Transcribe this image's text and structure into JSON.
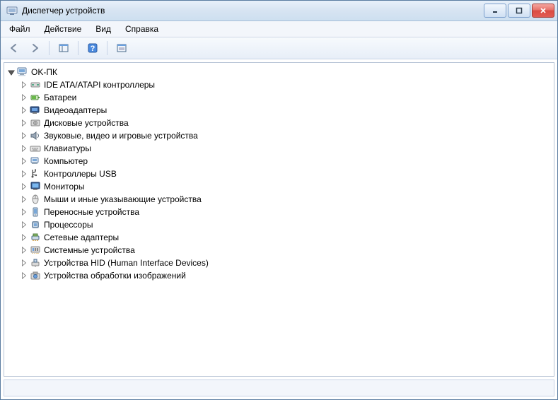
{
  "window": {
    "title": "Диспетчер устройств"
  },
  "menu": {
    "file": "Файл",
    "action": "Действие",
    "view": "Вид",
    "help": "Справка"
  },
  "tree": {
    "root": {
      "label": "OK-ПК",
      "expanded": true
    },
    "categories": [
      {
        "id": "ide",
        "label": "IDE ATA/ATAPI контроллеры",
        "icon": "controller-icon"
      },
      {
        "id": "battery",
        "label": "Батареи",
        "icon": "battery-icon"
      },
      {
        "id": "video",
        "label": "Видеоадаптеры",
        "icon": "display-adapter-icon"
      },
      {
        "id": "disk",
        "label": "Дисковые устройства",
        "icon": "disk-icon"
      },
      {
        "id": "sound",
        "label": "Звуковые, видео и игровые устройства",
        "icon": "sound-icon"
      },
      {
        "id": "keyboard",
        "label": "Клавиатуры",
        "icon": "keyboard-icon"
      },
      {
        "id": "computer",
        "label": "Компьютер",
        "icon": "computer-icon"
      },
      {
        "id": "usb",
        "label": "Контроллеры USB",
        "icon": "usb-icon"
      },
      {
        "id": "monitor",
        "label": "Мониторы",
        "icon": "monitor-icon"
      },
      {
        "id": "mouse",
        "label": "Мыши и иные указывающие устройства",
        "icon": "mouse-icon"
      },
      {
        "id": "portable",
        "label": "Переносные устройства",
        "icon": "portable-icon"
      },
      {
        "id": "processor",
        "label": "Процессоры",
        "icon": "processor-icon"
      },
      {
        "id": "network",
        "label": "Сетевые адаптеры",
        "icon": "network-icon"
      },
      {
        "id": "system",
        "label": "Системные устройства",
        "icon": "system-icon"
      },
      {
        "id": "hid",
        "label": "Устройства HID (Human Interface Devices)",
        "icon": "hid-icon"
      },
      {
        "id": "imaging",
        "label": "Устройства обработки изображений",
        "icon": "imaging-icon"
      }
    ]
  },
  "colors": {
    "titlebar_border": "#5a7ca0",
    "panel_border": "#b8c4d6",
    "close_red": "#d94b41"
  }
}
